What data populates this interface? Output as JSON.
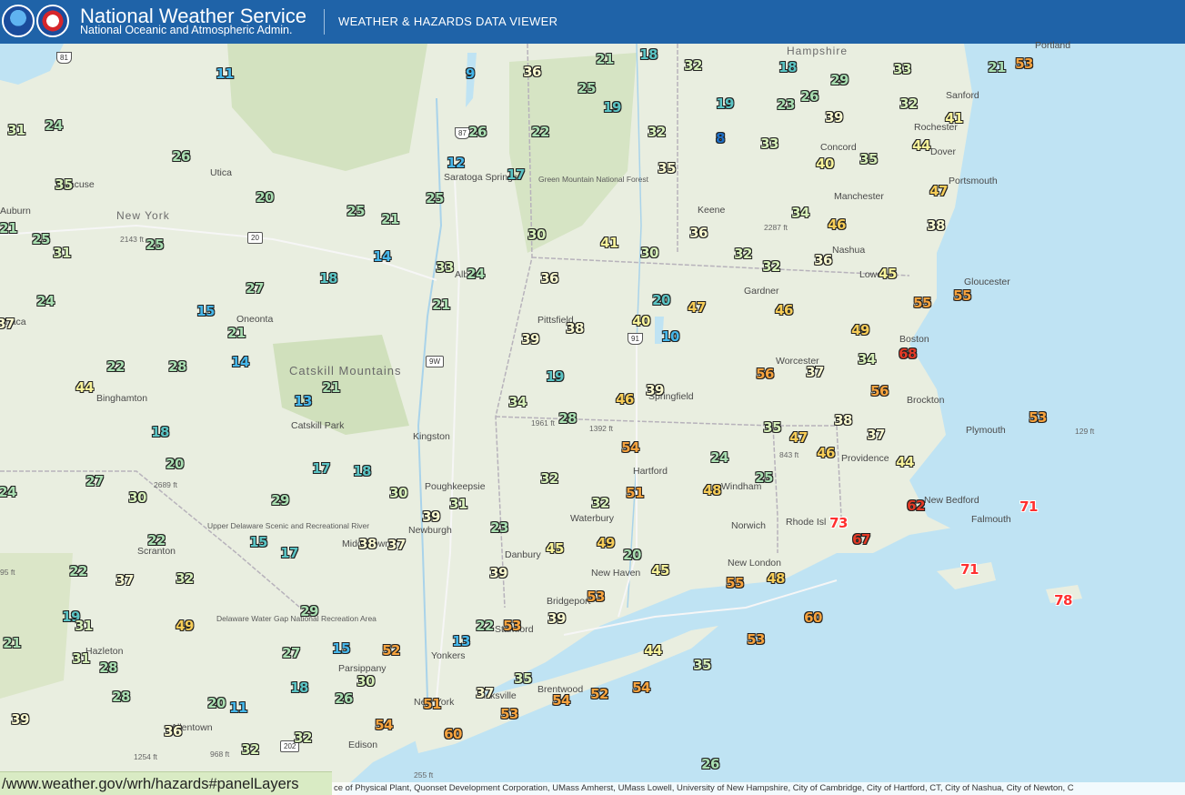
{
  "header": {
    "title": "National Weather Service",
    "subtitle": "National Oceanic and Atmospheric Admin.",
    "app_name": "WEATHER & HAZARDS DATA VIEWER",
    "logos": [
      "noaa-logo",
      "nws-logo"
    ],
    "background": "#1f63a8"
  },
  "colors": {
    "land": "#e9eee0",
    "water": "#bfe3f3",
    "forest": "#cfe0bb",
    "state_line": "#b5b0b8"
  },
  "map_labels": {
    "state_new_york": "New York",
    "state_hampshire": "Hampshire",
    "rhode_island": "Rhode Isl",
    "catskill_mountains": "Catskill Mountains",
    "cities": [
      "Portland",
      "Sanford",
      "Rochester",
      "Dover",
      "Portsmouth",
      "Concord",
      "Manchester",
      "Nashua",
      "Lowell",
      "Gloucester",
      "Boston",
      "Brockton",
      "Plymouth",
      "Worcester",
      "Gardner",
      "Keene",
      "Providence",
      "New Bedford",
      "Falmouth",
      "Springfield",
      "Pittsfield",
      "Hartford",
      "Windham",
      "Norwich",
      "New London",
      "Waterbury",
      "New Haven",
      "Bridgeport",
      "Danbury",
      "Stamford",
      "Yonkers",
      "New York",
      "Hicksville",
      "Brentwood",
      "Edison",
      "Allentown",
      "Parsippany",
      "Newburgh",
      "Poughkeepsie",
      "Kingston",
      "Middletown",
      "Scranton",
      "Hazleton",
      "Binghamton",
      "Oneonta",
      "Utica",
      "Syracuse",
      "Albany",
      "Saratoga Springs",
      "Catskill Park",
      "Auburn",
      "Ithaca"
    ],
    "parks": [
      "Green Mountain National Forest",
      "Upper Delaware Scenic and Recreational River",
      "Delaware Water Gap National Recreation Area"
    ],
    "elevations": [
      "2143 ft",
      "2689 ft",
      "2287 ft",
      "1961 ft",
      "1392 ft",
      "843 ft",
      "129 ft",
      "1254 ft",
      "968 ft",
      "255 ft",
      "95 ft"
    ],
    "shields": [
      "81",
      "87",
      "20",
      "9W",
      "91",
      "202"
    ]
  },
  "temperatures": [
    {
      "v": "11",
      "c": "blue"
    },
    {
      "v": "9",
      "c": "blue"
    },
    {
      "v": "36",
      "c": "cream"
    },
    {
      "v": "21",
      "c": "green"
    },
    {
      "v": "18",
      "c": "teal"
    },
    {
      "v": "32",
      "c": "lgreen"
    },
    {
      "v": "18",
      "c": "teal"
    },
    {
      "v": "33",
      "c": "lgreen"
    },
    {
      "v": "21",
      "c": "green"
    },
    {
      "v": "53",
      "c": "orange"
    },
    {
      "v": "31",
      "c": "lgreen"
    },
    {
      "v": "24",
      "c": "green"
    },
    {
      "v": "25",
      "c": "green"
    },
    {
      "v": "19",
      "c": "teal"
    },
    {
      "v": "19",
      "c": "teal"
    },
    {
      "v": "23",
      "c": "green"
    },
    {
      "v": "26",
      "c": "green"
    },
    {
      "v": "29",
      "c": "green"
    },
    {
      "v": "32",
      "c": "lgreen"
    },
    {
      "v": "26",
      "c": "green"
    },
    {
      "v": "26",
      "c": "green"
    },
    {
      "v": "22",
      "c": "green"
    },
    {
      "v": "32",
      "c": "lgreen"
    },
    {
      "v": "8",
      "c": "dblue"
    },
    {
      "v": "33",
      "c": "lgreen"
    },
    {
      "v": "39",
      "c": "cream"
    },
    {
      "v": "41",
      "c": "yellow"
    },
    {
      "v": "35",
      "c": "lgreen"
    },
    {
      "v": "12",
      "c": "blue"
    },
    {
      "v": "17",
      "c": "teal"
    },
    {
      "v": "35",
      "c": "cream"
    },
    {
      "v": "40",
      "c": "yellow"
    },
    {
      "v": "35",
      "c": "lgreen"
    },
    {
      "v": "44",
      "c": "yellow"
    },
    {
      "v": "20",
      "c": "green"
    },
    {
      "v": "25",
      "c": "green"
    },
    {
      "v": "21",
      "c": "green"
    },
    {
      "v": "21",
      "c": "green"
    },
    {
      "v": "47",
      "c": "amber"
    },
    {
      "v": "25",
      "c": "green"
    },
    {
      "v": "25",
      "c": "green"
    },
    {
      "v": "25",
      "c": "green"
    },
    {
      "v": "31",
      "c": "lgreen"
    },
    {
      "v": "14",
      "c": "blue"
    },
    {
      "v": "30",
      "c": "lgreen"
    },
    {
      "v": "41",
      "c": "yellow"
    },
    {
      "v": "30",
      "c": "lgreen"
    },
    {
      "v": "36",
      "c": "cream"
    },
    {
      "v": "34",
      "c": "lgreen"
    },
    {
      "v": "46",
      "c": "amber"
    },
    {
      "v": "38",
      "c": "cream"
    },
    {
      "v": "33",
      "c": "lgreen"
    },
    {
      "v": "24",
      "c": "green"
    },
    {
      "v": "32",
      "c": "lgreen"
    },
    {
      "v": "32",
      "c": "lgreen"
    },
    {
      "v": "36",
      "c": "cream"
    },
    {
      "v": "45",
      "c": "yellow"
    },
    {
      "v": "27",
      "c": "green"
    },
    {
      "v": "18",
      "c": "teal"
    },
    {
      "v": "36",
      "c": "cream"
    },
    {
      "v": "20",
      "c": "teal"
    },
    {
      "v": "47",
      "c": "amber"
    },
    {
      "v": "46",
      "c": "amber"
    },
    {
      "v": "55",
      "c": "orange"
    },
    {
      "v": "55",
      "c": "orange"
    },
    {
      "v": "24",
      "c": "green"
    },
    {
      "v": "15",
      "c": "blue"
    },
    {
      "v": "21",
      "c": "green"
    },
    {
      "v": "37",
      "c": "cream"
    },
    {
      "v": "21",
      "c": "green"
    },
    {
      "v": "40",
      "c": "yellow"
    },
    {
      "v": "39",
      "c": "cream"
    },
    {
      "v": "38",
      "c": "cream"
    },
    {
      "v": "10",
      "c": "blue"
    },
    {
      "v": "49",
      "c": "amber"
    },
    {
      "v": "68",
      "c": "red"
    },
    {
      "v": "22",
      "c": "green"
    },
    {
      "v": "28",
      "c": "green"
    },
    {
      "v": "14",
      "c": "blue"
    },
    {
      "v": "19",
      "c": "teal"
    },
    {
      "v": "56",
      "c": "orange"
    },
    {
      "v": "37",
      "c": "cream"
    },
    {
      "v": "34",
      "c": "lgreen"
    },
    {
      "v": "44",
      "c": "yellow"
    },
    {
      "v": "13",
      "c": "blue"
    },
    {
      "v": "21",
      "c": "green"
    },
    {
      "v": "34",
      "c": "lgreen"
    },
    {
      "v": "46",
      "c": "amber"
    },
    {
      "v": "39",
      "c": "cream"
    },
    {
      "v": "56",
      "c": "orange"
    },
    {
      "v": "18",
      "c": "teal"
    },
    {
      "v": "28",
      "c": "green"
    },
    {
      "v": "35",
      "c": "lgreen"
    },
    {
      "v": "38",
      "c": "cream"
    },
    {
      "v": "37",
      "c": "cream"
    },
    {
      "v": "53",
      "c": "orange"
    },
    {
      "v": "47",
      "c": "amber"
    },
    {
      "v": "20",
      "c": "green"
    },
    {
      "v": "54",
      "c": "orange"
    },
    {
      "v": "24",
      "c": "green"
    },
    {
      "v": "46",
      "c": "amber"
    },
    {
      "v": "44",
      "c": "yellow"
    },
    {
      "v": "27",
      "c": "green"
    },
    {
      "v": "17",
      "c": "teal"
    },
    {
      "v": "18",
      "c": "teal"
    },
    {
      "v": "32",
      "c": "lgreen"
    },
    {
      "v": "25",
      "c": "green"
    },
    {
      "v": "24",
      "c": "green"
    },
    {
      "v": "30",
      "c": "lgreen"
    },
    {
      "v": "29",
      "c": "green"
    },
    {
      "v": "30",
      "c": "lgreen"
    },
    {
      "v": "39",
      "c": "cream"
    },
    {
      "v": "31",
      "c": "lgreen"
    },
    {
      "v": "32",
      "c": "lgreen"
    },
    {
      "v": "51",
      "c": "orange"
    },
    {
      "v": "48",
      "c": "amber"
    },
    {
      "v": "73",
      "c": "red2"
    },
    {
      "v": "62",
      "c": "red"
    },
    {
      "v": "71",
      "c": "red2"
    },
    {
      "v": "22",
      "c": "green"
    },
    {
      "v": "15",
      "c": "teal"
    },
    {
      "v": "17",
      "c": "teal"
    },
    {
      "v": "38",
      "c": "cream"
    },
    {
      "v": "37",
      "c": "cream"
    },
    {
      "v": "23",
      "c": "green"
    },
    {
      "v": "45",
      "c": "yellow"
    },
    {
      "v": "49",
      "c": "amber"
    },
    {
      "v": "20",
      "c": "green"
    },
    {
      "v": "67",
      "c": "red"
    },
    {
      "v": "22",
      "c": "green"
    },
    {
      "v": "37",
      "c": "cream"
    },
    {
      "v": "32",
      "c": "lgreen"
    },
    {
      "v": "39",
      "c": "cream"
    },
    {
      "v": "45",
      "c": "yellow"
    },
    {
      "v": "55",
      "c": "orange"
    },
    {
      "v": "48",
      "c": "amber"
    },
    {
      "v": "71",
      "c": "red2"
    },
    {
      "v": "19",
      "c": "teal"
    },
    {
      "v": "49",
      "c": "amber"
    },
    {
      "v": "29",
      "c": "green"
    },
    {
      "v": "53",
      "c": "orange"
    },
    {
      "v": "78",
      "c": "red2"
    },
    {
      "v": "21",
      "c": "green"
    },
    {
      "v": "31",
      "c": "lgreen"
    },
    {
      "v": "28",
      "c": "green"
    },
    {
      "v": "27",
      "c": "green"
    },
    {
      "v": "15",
      "c": "blue"
    },
    {
      "v": "52",
      "c": "orange"
    },
    {
      "v": "13",
      "c": "blue"
    },
    {
      "v": "22",
      "c": "green"
    },
    {
      "v": "53",
      "c": "orange"
    },
    {
      "v": "39",
      "c": "cream"
    },
    {
      "v": "60",
      "c": "orange"
    },
    {
      "v": "53",
      "c": "orange"
    },
    {
      "v": "31",
      "c": "lgreen"
    },
    {
      "v": "30",
      "c": "lgreen"
    },
    {
      "v": "18",
      "c": "teal"
    },
    {
      "v": "44",
      "c": "yellow"
    },
    {
      "v": "35",
      "c": "lgreen"
    },
    {
      "v": "28",
      "c": "green"
    },
    {
      "v": "20",
      "c": "green"
    },
    {
      "v": "11",
      "c": "blue"
    },
    {
      "v": "26",
      "c": "green"
    },
    {
      "v": "51",
      "c": "orange"
    },
    {
      "v": "37",
      "c": "cream"
    },
    {
      "v": "35",
      "c": "lgreen"
    },
    {
      "v": "54",
      "c": "orange"
    },
    {
      "v": "52",
      "c": "orange"
    },
    {
      "v": "54",
      "c": "orange"
    },
    {
      "v": "39",
      "c": "cream"
    },
    {
      "v": "36",
      "c": "cream"
    },
    {
      "v": "32",
      "c": "lgreen"
    },
    {
      "v": "32",
      "c": "lgreen"
    },
    {
      "v": "54",
      "c": "orange"
    },
    {
      "v": "53",
      "c": "orange"
    },
    {
      "v": "60",
      "c": "orange"
    },
    {
      "v": "26",
      "c": "green"
    }
  ],
  "footer": {
    "url": "/www.weather.gov/wrh/hazards#panelLayers",
    "attribution": "ce of Physical Plant, Quonset Development Corporation, UMass Amherst, UMass Lowell, University of New Hampshire, City of Cambridge, City of Hartford, CT, City of Nashua, City of Newton, C"
  }
}
